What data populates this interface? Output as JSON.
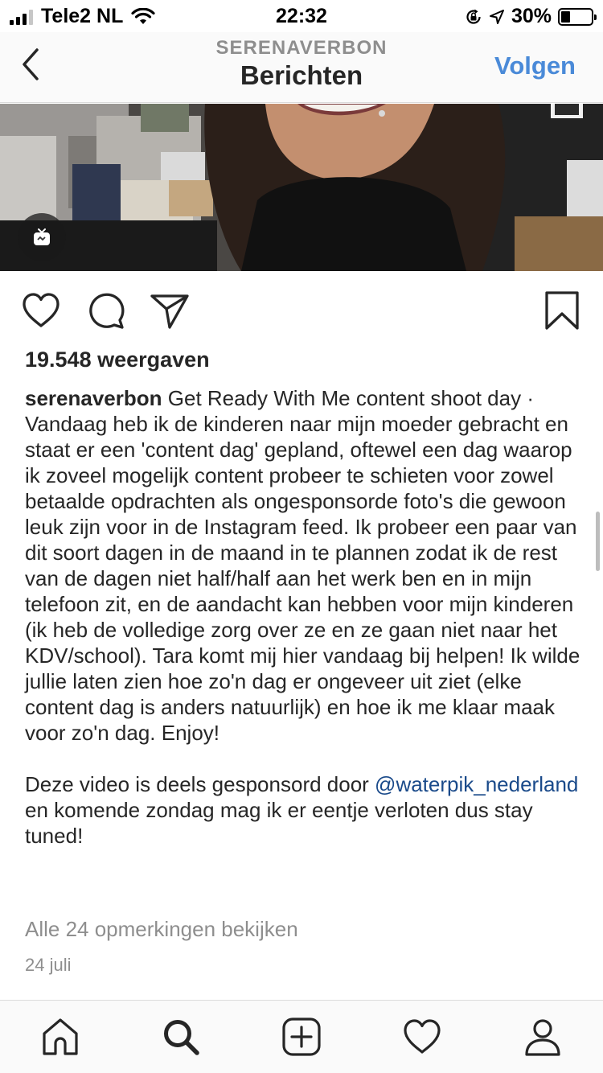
{
  "status_bar": {
    "carrier": "Tele2 NL",
    "time": "22:32",
    "battery": "30%",
    "battery_level": 0.3,
    "icons": [
      "signal-icon",
      "wifi-icon",
      "orientation-lock-icon",
      "location-icon",
      "battery-icon"
    ]
  },
  "header": {
    "subtitle": "SERENAVERBON",
    "title": "Berichten",
    "follow_label": "Volgen",
    "back_icon": "chevron-left-icon"
  },
  "media": {
    "badge_icon": "igtv-icon"
  },
  "actions": {
    "icons": [
      "heart-icon",
      "comment-icon",
      "share-icon",
      "bookmark-icon"
    ]
  },
  "post": {
    "views": "19.548 weergaven",
    "username": "serenaverbon",
    "caption_text": " Get Ready With Me  content shoot day · Vandaag heb ik de kinderen naar mijn moeder gebracht en staat er een 'content dag' gepland, oftewel een dag waarop ik zoveel mogelijk content probeer te schieten voor zowel betaalde opdrachten als ongesponsorde foto's die gewoon leuk zijn voor in de Instagram feed. Ik probeer een paar van dit soort dagen in de maand in te plannen zodat ik de rest van de dagen niet half/half aan het werk ben en in mijn telefoon zit, en de aandacht kan hebben voor mijn kinderen (ik heb de volledige zorg over ze en ze gaan niet naar het KDV/school). Tara komt mij hier vandaag bij helpen! Ik wilde jullie laten zien hoe zo'n dag er ongeveer uit ziet (elke content dag is anders natuurlijk) en hoe ik me klaar maak voor zo'n dag. Enjoy!\n\nDeze video is deels gesponsord door ",
    "mention": "@waterpik_nederland",
    "caption_end": " en komende zondag mag ik er eentje verloten dus stay tuned!",
    "view_comments": "Alle 24 opmerkingen bekijken",
    "date": "24 juli"
  },
  "tab_bar": {
    "icons": [
      "home-icon",
      "search-icon",
      "new-post-icon",
      "activity-icon",
      "profile-icon"
    ]
  },
  "colors": {
    "accent": "#4a8ad8",
    "mention": "#1a4a8a",
    "text": "#262626",
    "secondary_text": "#8e8e8e",
    "bar_background": "#fafafa",
    "divider": "#dbdbdb"
  }
}
